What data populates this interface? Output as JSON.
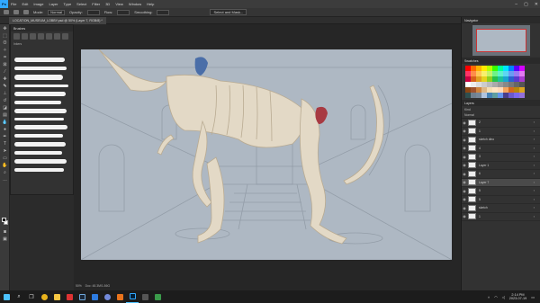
{
  "menubar": {
    "app_logo": "Ps",
    "items": [
      "File",
      "Edit",
      "Image",
      "Layer",
      "Type",
      "Select",
      "Filter",
      "3D",
      "View",
      "Window",
      "Help"
    ]
  },
  "options": {
    "mode_label": "Mode:",
    "mode_value": "Normal",
    "opacity_label": "Opacity:",
    "flow_label": "Flow:",
    "smoothing_label": "Smoothing:",
    "subject_button": "Select and Mask..."
  },
  "document": {
    "tab_label": "LOCATION_MUSEUM_LOBBY.psd @ 50% (Layer 7, RGB/8) *"
  },
  "brushes": {
    "panel_title": "Brushes",
    "group_label": "Inkers",
    "stroke_count": 14
  },
  "status": {
    "zoom": "50%",
    "doc_info": "Doc: 48.3M/1.86G"
  },
  "navigator": {
    "title": "Navigator"
  },
  "swatches": {
    "title": "Swatches",
    "colors": [
      "#ff0000",
      "#ff6a00",
      "#ffb300",
      "#ffea00",
      "#b6ff00",
      "#38ff00",
      "#00ff9a",
      "#00e5ff",
      "#0084ff",
      "#5a00ff",
      "#d400ff",
      "#ff3366",
      "#ff8c4a",
      "#ffc857",
      "#f7f06d",
      "#c3f26a",
      "#6ef287",
      "#5ff2cc",
      "#5dd6f2",
      "#6a9cf2",
      "#9b7af2",
      "#e27af2",
      "#cc0044",
      "#d95f1a",
      "#e0a020",
      "#e6d21e",
      "#8fd01e",
      "#26c24a",
      "#1ec29a",
      "#1aa6cf",
      "#2a62cf",
      "#5a3acf",
      "#a83acf",
      "#ffffff",
      "#eeeeee",
      "#dddddd",
      "#cccccc",
      "#bbbbbb",
      "#aaaaaa",
      "#999999",
      "#888888",
      "#777777",
      "#666666",
      "#555555",
      "#8b4513",
      "#a0522d",
      "#cd853f",
      "#deb887",
      "#f5deb3",
      "#ffe4c4",
      "#ffdab9",
      "#f4a460",
      "#d2691e",
      "#b8860b",
      "#daa520",
      "#2f4f4f",
      "#708090",
      "#778899",
      "#b0c4de",
      "#4682b4",
      "#5f9ea0",
      "#6495ed",
      "#483d8b",
      "#6a5acd",
      "#7b68ee",
      "#9370db"
    ]
  },
  "layers": {
    "title": "Layers",
    "kind_label": "Kind",
    "blend_mode": "Normal",
    "rows": [
      {
        "name": "2",
        "active": false
      },
      {
        "name": "1",
        "active": false
      },
      {
        "name": "sketch dino",
        "active": false
      },
      {
        "name": "4",
        "active": false
      },
      {
        "name": "3",
        "active": false
      },
      {
        "name": "Layer 1",
        "active": false
      },
      {
        "name": "6",
        "active": false
      },
      {
        "name": "Layer 7",
        "active": true
      },
      {
        "name": "5",
        "active": false
      },
      {
        "name": "5",
        "active": false
      },
      {
        "name": "sketch",
        "active": false
      },
      {
        "name": "1",
        "active": false
      }
    ]
  },
  "taskbar": {
    "time": "2:14 PM",
    "date": "2023-07-19"
  }
}
